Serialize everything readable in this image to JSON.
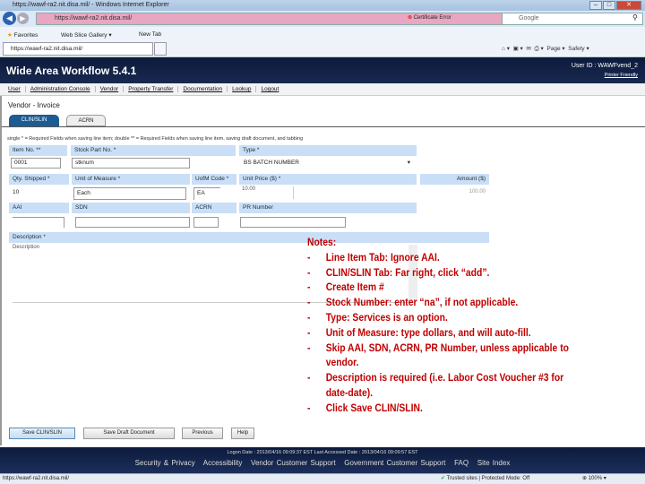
{
  "browser": {
    "title": "https://wawf-ra2.nit.disa.mil/ - Windows Internet Explorer",
    "url": "https://wawf-ra2.nit.disa.mil/",
    "cert_error": "Certificate Error",
    "search_placeholder": "Google",
    "favorites": "Favorites",
    "web_slice": "Web Slice Gallery",
    "new_tab": "New Tab",
    "tab_title": "https://wawf-ra2.nit.disa.mil/",
    "page_menu": "Page",
    "safety_menu": "Safety",
    "status_url": "https://wawf-ra2.nit.disa.mil/",
    "zone": "Trusted sites | Protected Mode: Off",
    "zoom": "100%"
  },
  "header": {
    "title": "Wide Area Workflow 5.4.1",
    "user_id": "User ID : WAWFvend_2",
    "printer_friendly": "Printer Friendly"
  },
  "menu": [
    "User",
    "Administration Console",
    "Vendor",
    "Property Transfer",
    "Documentation",
    "Lookup",
    "Logout"
  ],
  "page": {
    "title": "Vendor - Invoice",
    "tabs": [
      "CLIN/SLIN",
      "ACRN"
    ],
    "required_note": "single * = Required Fields when saving line item; double ** = Required Fields when saving line item, saving draft document, and tabbing"
  },
  "form": {
    "item_no_label": "Item No. **",
    "item_no": "0001",
    "stock_label": "Stock Part No. *",
    "stock": "stknum",
    "type_label": "Type *",
    "type": "BS  BATCH NUMBER",
    "qty_label": "Qty. Shipped *",
    "qty": "10",
    "uom_label": "Unit of Measure *",
    "uom": "Each",
    "uom_code_label": "UofM Code *",
    "uom_code": "EA",
    "unit_price_label": "Unit Price ($) *",
    "unit_price": "10.00",
    "amount_label": "Amount ($)",
    "amount": "100.00",
    "aai_label": "AAI",
    "sdn_label": "SDN",
    "acrn_label": "ACRN",
    "pr_label": "PR Number",
    "description_label": "Description *",
    "description": "Description"
  },
  "buttons": {
    "save_clin": "Save CLIN/SLIN",
    "save_draft": "Save Draft Document",
    "previous": "Previous",
    "help": "Help"
  },
  "footer": {
    "dates": "Logon Date : 2013/04/16 09:09:37 EST    Last Accessed Date : 2013/04/16 09:09:57 EST",
    "links": [
      "Security & Privacy",
      "Accessibility",
      "Vendor Customer Support",
      "Government Customer Support",
      "FAQ",
      "Site Index"
    ]
  },
  "notes": {
    "title": "Notes:",
    "items": [
      "Line Item Tab: Ignore AAI.",
      "CLIN/SLIN Tab:  Far right, click “add”.",
      "Create Item #",
      "Stock Number: enter “na”, if not applicable.",
      "Type: Services is an option.",
      "Unit of Measure: type dollars, and will auto-fill.",
      "Skip AAI, SDN, ACRN, PR Number, unless applicable to vendor.",
      "Description is required (i.e. Labor Cost Voucher #3 for date-date).",
      "Click Save CLIN/SLIN."
    ]
  }
}
